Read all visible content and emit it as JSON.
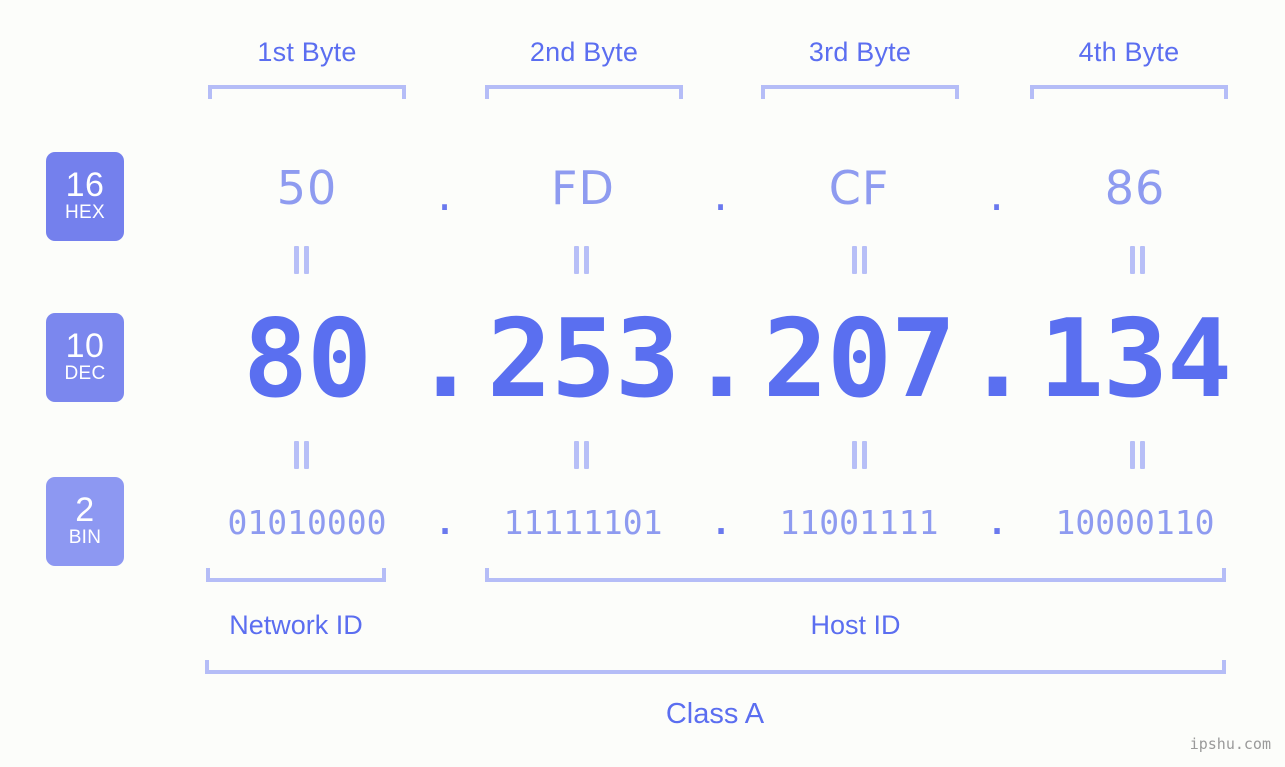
{
  "watermark": "ipshu.com",
  "byte_headers": [
    {
      "label": "1st Byte"
    },
    {
      "label": "2nd Byte"
    },
    {
      "label": "3rd Byte"
    },
    {
      "label": "4th Byte"
    }
  ],
  "bases": [
    {
      "number": "16",
      "name": "HEX",
      "color": "#7480ed"
    },
    {
      "number": "10",
      "name": "DEC",
      "color": "#7b87ee"
    },
    {
      "number": "2",
      "name": "BIN",
      "color": "#8d98f2"
    }
  ],
  "separator": ".",
  "equals_symbol": "=",
  "rows": {
    "hex": {
      "base_label": "HEX",
      "octets": [
        "50",
        "FD",
        "CF",
        "86"
      ]
    },
    "dec": {
      "base_label": "DEC",
      "octets": [
        "80",
        "253",
        "207",
        "134"
      ]
    },
    "bin": {
      "base_label": "BIN",
      "octets": [
        "01010000",
        "11111101",
        "11001111",
        "10000110"
      ]
    }
  },
  "address": {
    "decimal": "80.253.207.134",
    "hexadecimal": "50.FD.CF.86",
    "binary": "01010000.11111101.11001111.10000110"
  },
  "segments": {
    "network_id": "Network ID",
    "host_id": "Host ID",
    "class": "Class A"
  },
  "colors": {
    "background": "#fcfdfa",
    "accent_strong": "#5a6ff0",
    "accent_light": "#8e9bf0",
    "bracket": "#b5bdf7",
    "badge_hex": "#7480ed",
    "badge_dec": "#7b87ee",
    "badge_bin": "#8d98f2",
    "watermark": "#9a9a9a"
  }
}
